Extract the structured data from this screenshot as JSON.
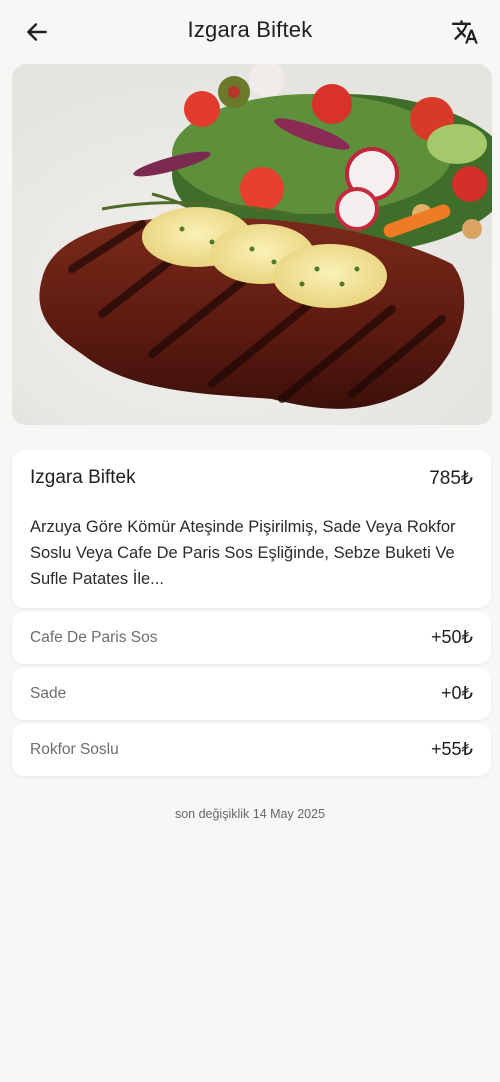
{
  "header": {
    "title": "Izgara Biftek",
    "back_icon": "arrow-left-icon",
    "translate_icon": "translate-icon"
  },
  "hero": {
    "image": "grilled-steak-with-herb-butter-and-salad"
  },
  "item": {
    "name": "Izgara Biftek",
    "price": "785₺",
    "description": "Arzuya Göre Kömür Ateşinde Pişirilmiş, Sade Veya Rokfor Soslu Veya Cafe De Paris Sos Eşliğinde, Sebze Buketi Ve Sufle Patates İle..."
  },
  "options": [
    {
      "label": "Cafe De Paris Sos",
      "price": "+50₺"
    },
    {
      "label": "Sade",
      "price": "+0₺"
    },
    {
      "label": "Rokfor Soslu",
      "price": "+55₺"
    }
  ],
  "footer": {
    "last_modified": "son değişiklik 14 May 2025"
  },
  "colors": {
    "background": "#f7f7f5",
    "card": "#ffffff",
    "text": "#1f1f1f",
    "muted": "#6d6d6d"
  }
}
